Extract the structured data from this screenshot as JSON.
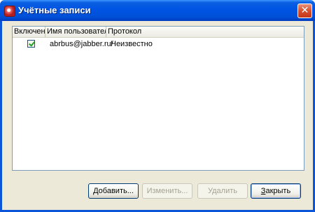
{
  "window": {
    "title": "Учётные записи",
    "close_glyph": "✕"
  },
  "table": {
    "columns": [
      "Включено",
      "Имя пользователя",
      "Протокол"
    ],
    "rows": [
      {
        "enabled": true,
        "username": "abrbus@jabber.ru/",
        "protocol": "Неизвестно"
      }
    ]
  },
  "buttons": {
    "add": {
      "label_ul": "Д",
      "label_rest": "обавить...",
      "enabled": true
    },
    "edit": {
      "label": "Изменить...",
      "enabled": false
    },
    "delete": {
      "label": "Удалить",
      "enabled": false
    },
    "close": {
      "label_ul": "З",
      "label_rest": "акрыть",
      "enabled": true
    }
  },
  "colors": {
    "titlebar": "#0054e3",
    "frame": "#0a55d8",
    "dialog_bg": "#ece9d8",
    "check": "#21a121"
  }
}
